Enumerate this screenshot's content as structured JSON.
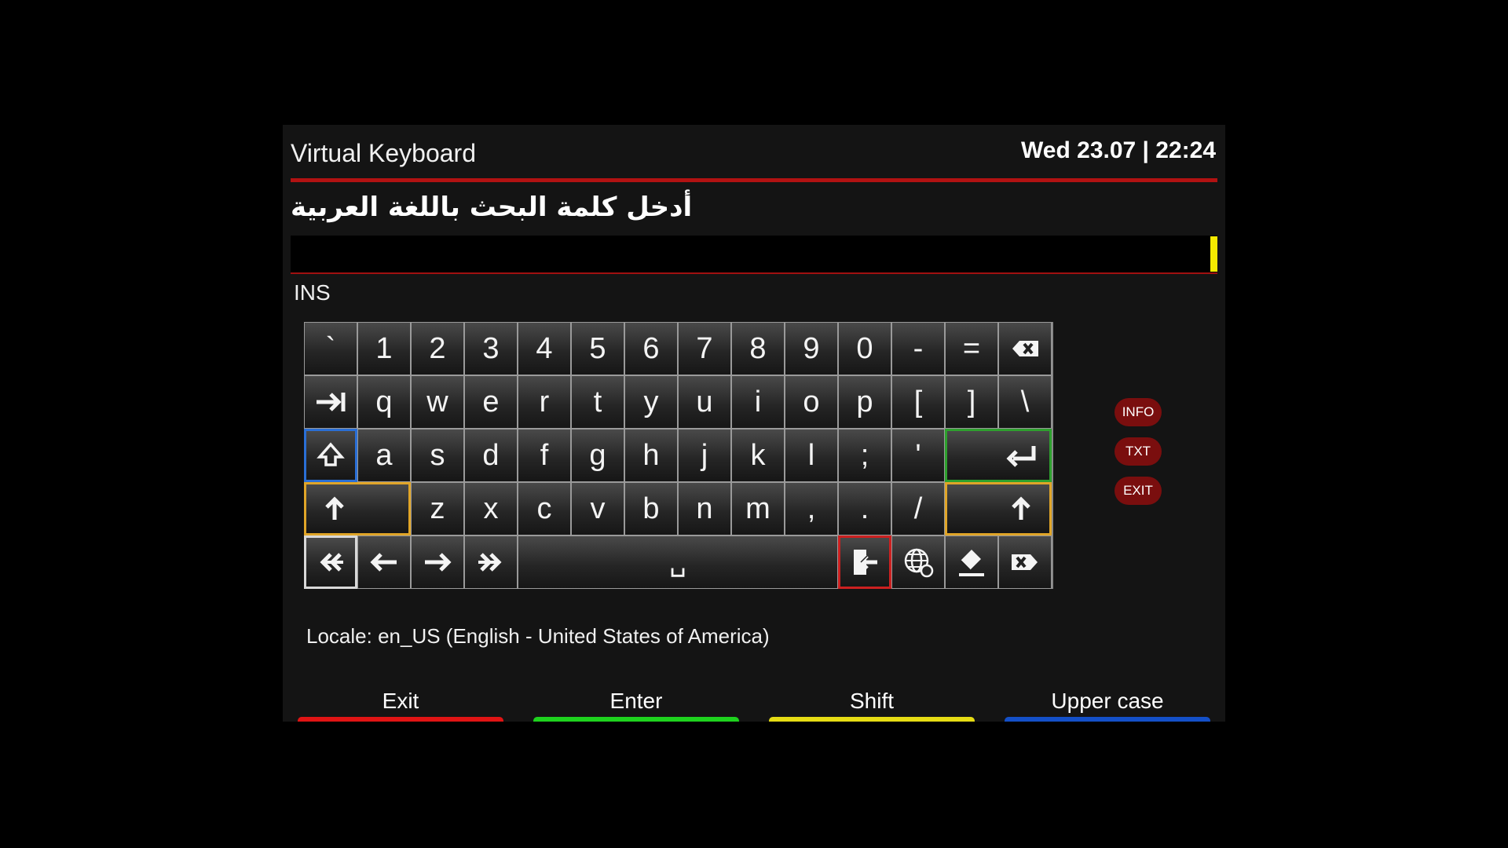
{
  "header": {
    "title": "Virtual Keyboard",
    "datetime": "Wed 23.07 | 22:24"
  },
  "prompt": "أدخل كلمة البحث باللغة العربية",
  "input": {
    "value": ""
  },
  "mode": "INS",
  "keys": {
    "row1": [
      "`",
      "1",
      "2",
      "3",
      "4",
      "5",
      "6",
      "7",
      "8",
      "9",
      "0",
      "-",
      "="
    ],
    "row2": [
      "q",
      "w",
      "e",
      "r",
      "t",
      "y",
      "u",
      "i",
      "o",
      "p",
      "[",
      "]",
      "\\"
    ],
    "row3": [
      "a",
      "s",
      "d",
      "f",
      "g",
      "h",
      "j",
      "k",
      "l",
      ";",
      "'"
    ],
    "row4": [
      "z",
      "x",
      "c",
      "v",
      "b",
      "n",
      "m",
      ",",
      ".",
      "/"
    ],
    "space": "␣"
  },
  "side_buttons": {
    "info": "INFO",
    "txt": "TXT",
    "exit": "EXIT"
  },
  "locale": "Locale: en_US  (English - United States of America)",
  "footer": {
    "exit_label": "Exit",
    "enter_label": "Enter",
    "shift_label": "Shift",
    "upper_label": "Upper case"
  },
  "colors": {
    "accent": "#b21212",
    "cursor": "#f5ea00",
    "red": "#e01414",
    "green": "#1ed21e",
    "yellow": "#e6dc14",
    "blue": "#1450c8"
  }
}
